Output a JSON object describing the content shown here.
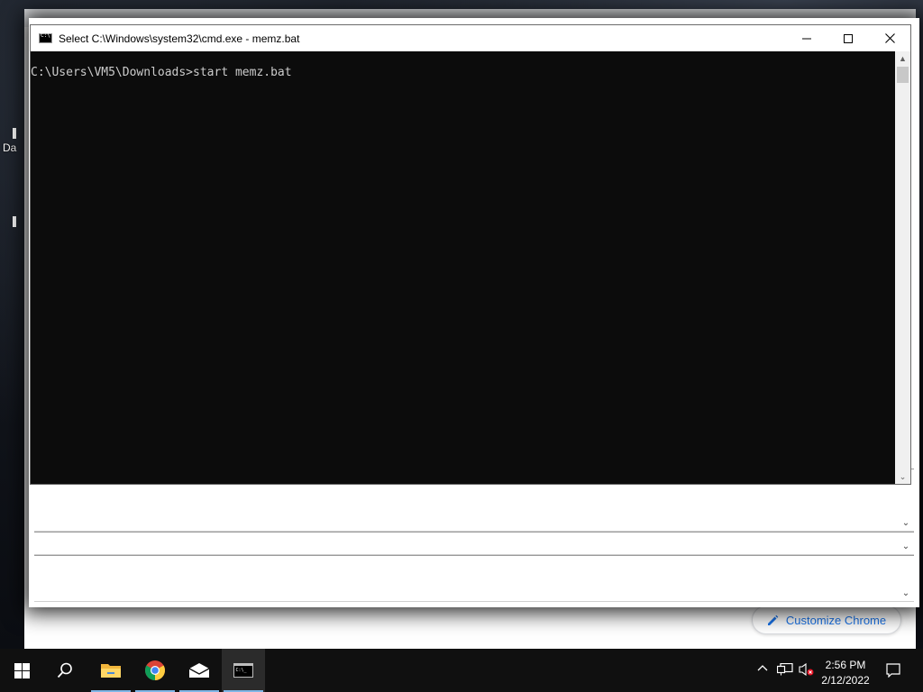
{
  "desktop": {
    "icon_label": "Da"
  },
  "chrome": {
    "customize_label": "Customize Chrome"
  },
  "cmd": {
    "title": "Select C:\\Windows\\system32\\cmd.exe - memz.bat",
    "prompt_line": "C:\\Users\\VM5\\Downloads>start memz.bat"
  },
  "taskbar": {
    "items": [
      "start-icon",
      "search-icon",
      "file-explorer-icon",
      "chrome-icon",
      "mail-icon",
      "cmd-icon"
    ],
    "clock_time": "2:56 PM",
    "clock_date": "2/12/2022"
  },
  "colors": {
    "console_bg": "#0c0c0c",
    "console_text": "#cccccc",
    "taskbar_bg": "#101010",
    "accent": "#1a73e8"
  }
}
